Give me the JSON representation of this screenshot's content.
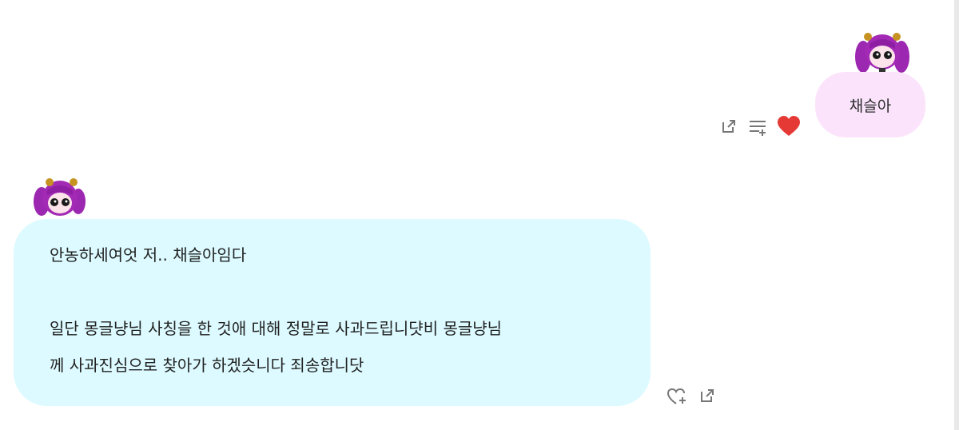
{
  "conversation": {
    "my_message": {
      "text": "채슬아",
      "avatar_icon": "purple-haired-girl-avatar"
    },
    "other_message": {
      "avatar_icon": "purple-haired-girl-avatar",
      "lines": [
        "안농하세여엇 저.. 채슬아임다",
        "일단 몽글냥님 사칭을 한 것애 대해 정말로 사과드립니댯비 몽글냥님",
        "께 사과진심으로 찾아가 하겠슷니다 죄송합니닷"
      ]
    }
  },
  "actions": {
    "my_message": [
      "share-icon",
      "queue-icon",
      "heart-icon"
    ],
    "other_message": [
      "like-outline-icon",
      "share-icon"
    ]
  },
  "colors": {
    "my_bubble": "#fbe4fb",
    "other_bubble": "#dcfaff",
    "heart": "#e53935",
    "icon_gray": "#777777"
  }
}
